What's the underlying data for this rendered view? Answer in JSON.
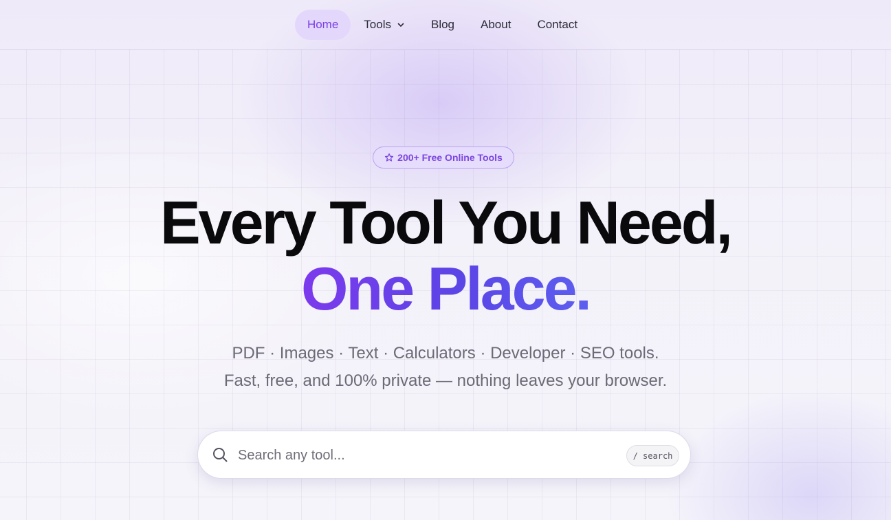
{
  "nav": {
    "items": [
      {
        "label": "Home",
        "active": true
      },
      {
        "label": "Tools",
        "dropdown": true
      },
      {
        "label": "Blog"
      },
      {
        "label": "About"
      },
      {
        "label": "Contact"
      }
    ]
  },
  "hero": {
    "badge": "200+ Free Online Tools",
    "headline_line1": "Every Tool You Need,",
    "headline_line2": "One Place.",
    "subtitle_line1": "PDF · Images · Text · Calculators · Developer · SEO tools.",
    "subtitle_line2": "Fast, free, and 100% private — nothing leaves your browser."
  },
  "search": {
    "placeholder": "Search any tool...",
    "value": "",
    "shortcut_hint": "/ search"
  },
  "colors": {
    "accent": "#7c3aed",
    "accent_gradient_end": "#5d5ff0",
    "badge_bg": "#e6dcfb",
    "active_nav_bg": "#e3d8fb"
  },
  "icons": {
    "badge": "star-icon",
    "tools_dropdown": "chevron-down-icon",
    "search": "search-icon"
  }
}
